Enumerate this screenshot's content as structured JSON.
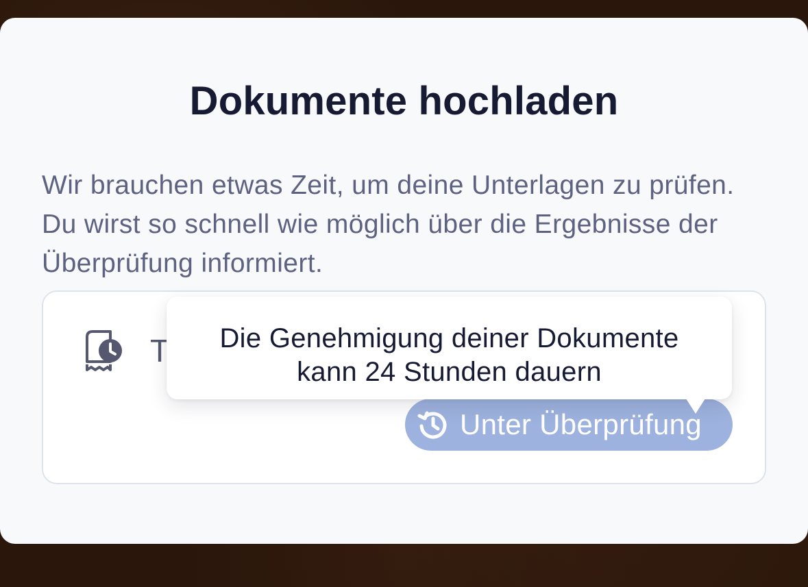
{
  "modal": {
    "title": "Dokumente hochladen",
    "description": "Wir brauchen etwas Zeit, um deine Unterlagen zu prüfen. Du wirst so schnell wie möglich über die Ergebnisse der Überprüfung informiert."
  },
  "document": {
    "icon": "receipt-clock-icon",
    "name_visible": "T",
    "status": {
      "label": "Unter Überprüfung",
      "icon": "history-clock-icon",
      "color": "#9db2de"
    }
  },
  "tooltip": {
    "line1": "Die Genehmigung deiner Dokumente",
    "line2": "kann 24 Stunden dauern"
  },
  "colors": {
    "title": "#161a33",
    "description": "#5e6281",
    "modal_background": "#f8f9fb",
    "backdrop": "#2a160b"
  }
}
